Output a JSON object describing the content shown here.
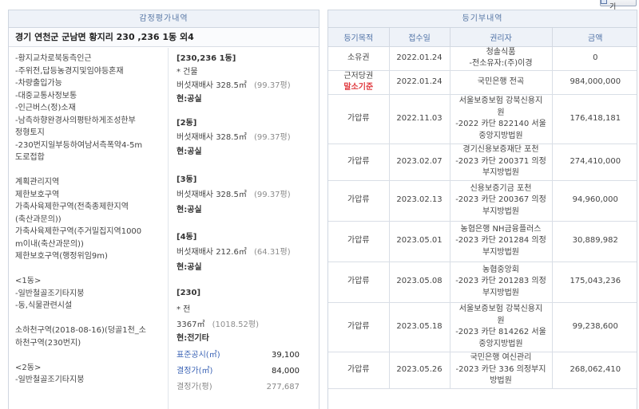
{
  "print_button": "인쇄하기",
  "left": {
    "title": "감정평가내역",
    "address": "경기 연천군 군남면 황지리 230 ,236 1동 외4",
    "features": [
      "-황지교차로북동측인근",
      "-주위전,답등농경지및임야등혼재",
      "-차량출입가능",
      "-대중교통사정보통",
      "-인근버스(정)소재",
      "-남측하향완경사의평탄하게조성한부",
      "정형토지",
      "-230번지일부등하여남서측폭약4-5m",
      "도로접합",
      "",
      "계획관리지역",
      "제한보호구역",
      "가축사육제한구역(전축종제한지역",
      "(축산과문의))",
      "가축사육제한구역(주거밀집지역1000",
      "m이내(축산과문의))",
      "제한보호구역(행정위임9m)",
      "",
      "<1동>",
      "-일반철골조기타지붕",
      "-동,식물관련시설",
      "",
      "소하천구역(2018-08-16)(덩골1천_소",
      "하천구역(230번지)",
      "",
      "<2동>",
      "-일반철골조기타지붕"
    ],
    "buildings": [
      {
        "title": "[230,236 1동]",
        "type": "* 건물",
        "use": "버섯재배사",
        "area": "328.5㎡",
        "pyeong": "(99.37평)",
        "status": "현:공실"
      },
      {
        "title": "[2동]",
        "use": "버섯재배사",
        "area": "328.5㎡",
        "pyeong": "(99.37평)",
        "status": "현:공실"
      },
      {
        "title": "[3동]",
        "use": "버섯재배사",
        "area": "328.5㎡",
        "pyeong": "(99.37평)",
        "status": "현:공실"
      },
      {
        "title": "[4동]",
        "use": "버섯재배사",
        "area": "212.6㎡",
        "pyeong": "(64.31평)",
        "status": "현:공실"
      }
    ],
    "land": {
      "title": "[230]",
      "type": "* 전",
      "area": "3367㎡",
      "pyeong": "(1018.52평)",
      "status": "현:전기타",
      "prices": [
        {
          "label": "표준공시(㎡)",
          "value": "39,100"
        },
        {
          "label": "결정가(㎡)",
          "value": "84,000"
        },
        {
          "label": "결정가(평)",
          "value": "277,687"
        }
      ]
    }
  },
  "right": {
    "title": "등기부내역",
    "columns": [
      "등기목적",
      "접수일",
      "권리자",
      "금액"
    ],
    "rows": [
      {
        "purpose": "소유권",
        "date": "2022.01.24",
        "holder": [
          "청솔식품",
          "-전소유자:(주)이경"
        ],
        "amount": "0"
      },
      {
        "purpose": "근저당권",
        "tag": "말소기준",
        "date": "2022.01.24",
        "holder": [
          "국민은행 전곡"
        ],
        "amount": "984,000,000"
      },
      {
        "purpose": "가압류",
        "date": "2022.11.03",
        "holder": [
          "서울보증보험 강북신용지",
          "원",
          "-2022 카단 822140 서울",
          "중앙지방법원"
        ],
        "amount": "176,418,181"
      },
      {
        "purpose": "가압류",
        "date": "2023.02.07",
        "holder": [
          "경기신용보증재단 포천",
          "-2023 카단 200371 의정",
          "부지방법원"
        ],
        "amount": "274,410,000"
      },
      {
        "purpose": "가압류",
        "date": "2023.02.13",
        "holder": [
          "신용보증기금 포천",
          "-2023 카단 200367 의정",
          "부지방법원"
        ],
        "amount": "94,960,000"
      },
      {
        "purpose": "가압류",
        "date": "2023.05.01",
        "holder": [
          "농협은행 NH금융플러스",
          "-2023 카단 201284 의정",
          "부지방법원"
        ],
        "amount": "30,889,982"
      },
      {
        "purpose": "가압류",
        "date": "2023.05.08",
        "holder": [
          "농협중앙회",
          "-2023 카단 201283 의정",
          "부지방법원"
        ],
        "amount": "175,043,236"
      },
      {
        "purpose": "가압류",
        "date": "2023.05.18",
        "holder": [
          "서울보증보험 강북신용지",
          "원",
          "-2023 카단 814262 서울",
          "중앙지방법원"
        ],
        "amount": "99,238,600"
      },
      {
        "purpose": "가압류",
        "date": "2023.05.26",
        "holder": [
          "국민은행 여신관리",
          "-2023 카단 336 의정부지",
          "방법원"
        ],
        "amount": "268,062,410"
      }
    ]
  }
}
